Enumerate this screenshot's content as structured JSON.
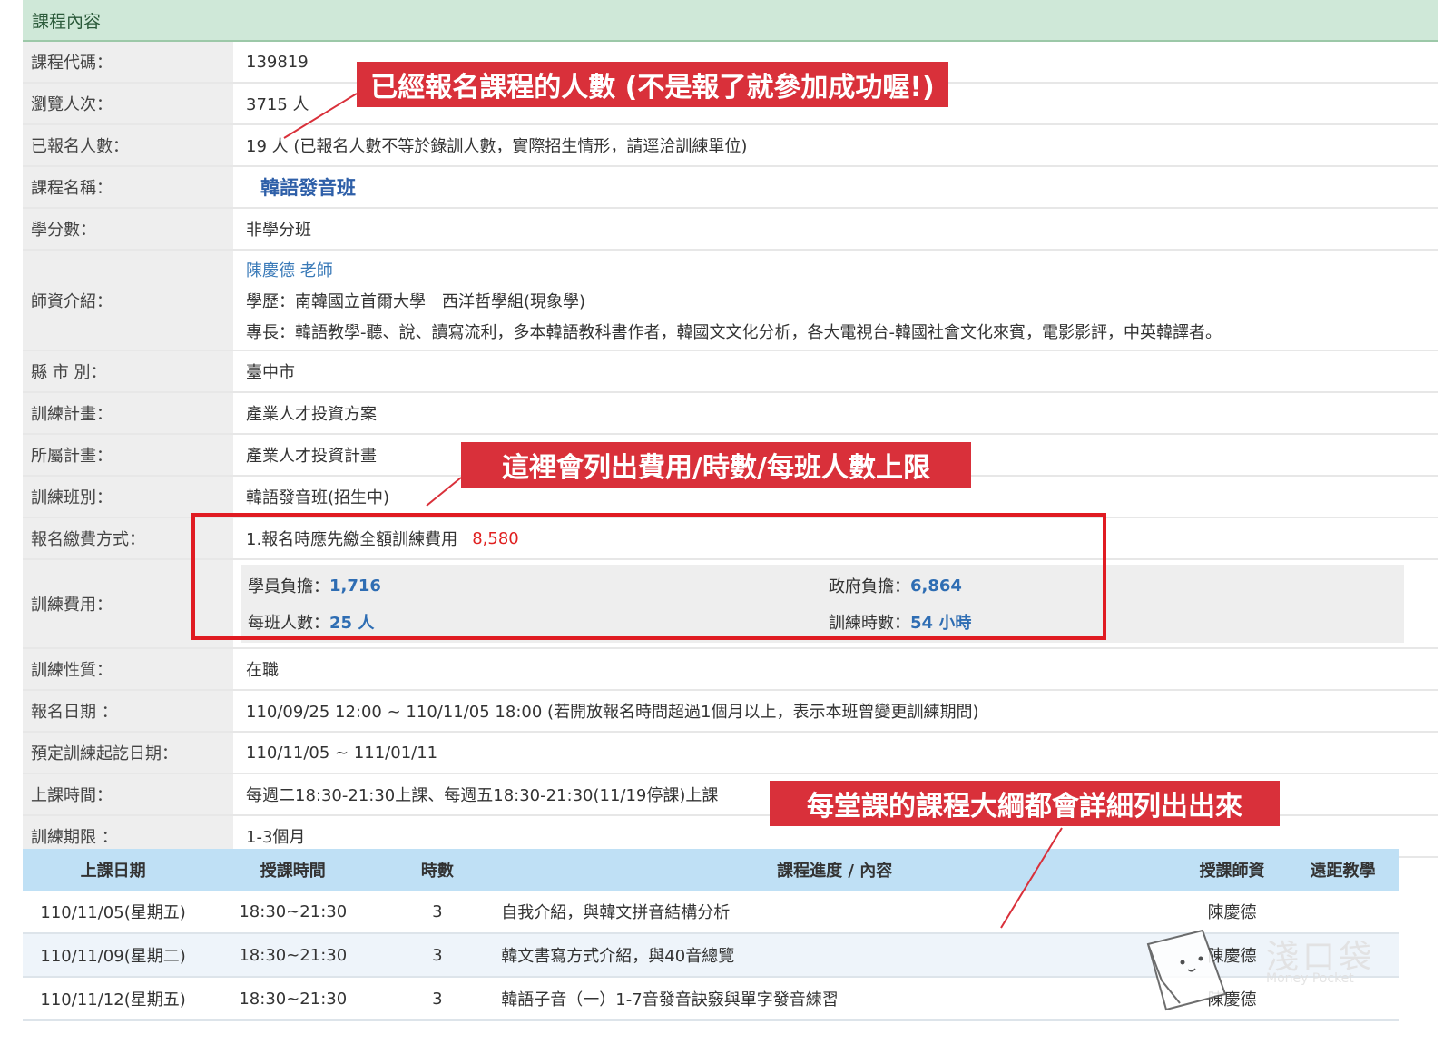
{
  "panel": {
    "title": "課程內容"
  },
  "fields": [
    {
      "label": "課程代碼：",
      "value": "139819"
    },
    {
      "label": "瀏覽人次：",
      "value": "3715 人"
    },
    {
      "label": "已報名人數：",
      "value": "19 人 (已報名人數不等於錄訓人數，實際招生情形，請逕洽訓練單位)"
    },
    {
      "label": "課程名稱：",
      "value": "韓語發音班"
    },
    {
      "label": "學分數：",
      "value": "非學分班"
    },
    {
      "label": "縣 市 別：",
      "value": "臺中市"
    },
    {
      "label": "訓練計畫：",
      "value": "產業人才投資方案"
    },
    {
      "label": "所屬計畫：",
      "value": "產業人才投資計畫"
    },
    {
      "label": "訓練班別：",
      "value": "韓語發音班(招生中)"
    }
  ],
  "teacher": {
    "label": "師資介紹：",
    "name": "陳慶德 老師",
    "education": "學歷：南韓國立首爾大學　西洋哲學組(現象學)",
    "expertise": "專長：韓語教學-聽、說、讀寫流利，多本韓語教科書作者，韓國文文化分析，各大電視台-韓國社會文化來賓，電影影評，中英韓譯者。"
  },
  "payment": {
    "label": "報名繳費方式：",
    "text": "1.報名時應先繳全額訓練費用",
    "amount": "8,580"
  },
  "fee": {
    "label": "訓練費用：",
    "student_label": "學員負擔：",
    "student_value": "1,716",
    "gov_label": "政府負擔：",
    "gov_value": "6,864",
    "class_label": "每班人數：",
    "class_value": "25 人",
    "hours_label": "訓練時數：",
    "hours_value": "54 小時"
  },
  "fields2": [
    {
      "label": "訓練性質：",
      "value": "在職"
    },
    {
      "label": "報名日期 ：",
      "value": "110/09/25 12:00 ~ 110/11/05 18:00 (若開放報名時間超過1個月以上，表示本班曾變更訓練期間)"
    },
    {
      "label": "預定訓練起訖日期：",
      "value": "110/11/05 ~ 111/01/11"
    },
    {
      "label": "上課時間：",
      "value": "每週二18:30-21:30上課、每週五18:30-21:30(11/19停課)上課"
    },
    {
      "label": "訓練期限 ：",
      "value": "1-3個月"
    }
  ],
  "schedule": {
    "headers": [
      "上課日期",
      "授課時間",
      "時數",
      "課程進度 / 內容",
      "授課師資",
      "遠距教學"
    ],
    "rows": [
      [
        "110/11/05(星期五)",
        "18:30~21:30",
        "3",
        "自我介紹，與韓文拼音結構分析",
        "陳慶德",
        ""
      ],
      [
        "110/11/09(星期二)",
        "18:30~21:30",
        "3",
        "韓文書寫方式介紹，與40音總覽",
        "陳慶德",
        ""
      ],
      [
        "110/11/12(星期五)",
        "18:30~21:30",
        "3",
        "韓語子音（一）1-7音發音訣竅與單字發音練習",
        "陳慶德",
        ""
      ]
    ]
  },
  "annotations": {
    "signup": "已經報名課程的人數 (不是報了就參加成功喔!)",
    "fees": "這裡會列出費用/時數/每班人數上限",
    "outline": "每堂課的課程大綱都會詳細列出出來"
  },
  "watermark": {
    "title": "淺口袋",
    "subtitle": "Money Pocket"
  },
  "colors": {
    "header_green": "#cfe8d8",
    "table_header_blue": "#bfe0f5",
    "annotation_red": "#d9303a",
    "highlight_red": "#e01b22",
    "link_blue": "#2e6db3"
  }
}
